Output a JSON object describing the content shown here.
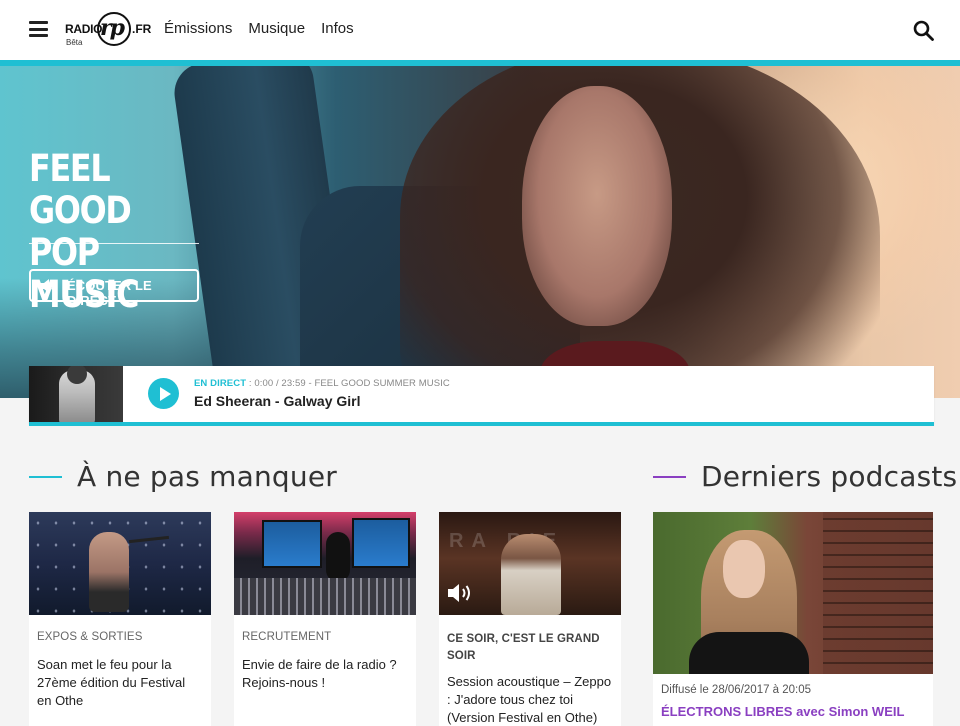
{
  "header": {
    "logo_left": "RADIO",
    "logo_mark": "rp",
    "logo_right": ".FR",
    "logo_badge": "Bêta",
    "nav": [
      "Émissions",
      "Musique",
      "Infos"
    ],
    "accent_color": "#1fbfd3"
  },
  "hero": {
    "title": "FEEL GOOD POP MUSIC",
    "listen_label": "ÉCOUTER LE DIRECT"
  },
  "player": {
    "live_label": "EN DIRECT",
    "schedule": " : 0:00 / 23:59 - FEEL GOOD SUMMER MUSIC",
    "track": "Ed Sheeran - Galway Girl"
  },
  "sections": {
    "featured_title": "À ne pas manquer",
    "featured_color": "#1fbfd3",
    "podcasts_title": "Derniers podcasts",
    "podcasts_color": "#8a3fc1"
  },
  "cards": [
    {
      "category": "EXPOS & SORTIES",
      "text": "Soan met le feu pour la 27ème édition du Festival en Othe",
      "icon": "person-singing-image"
    },
    {
      "category": "RECRUTEMENT",
      "text": "Envie de faire de la radio ? Rejoins-nous !",
      "icon": "radio-studio-image"
    },
    {
      "category": "CE SOIR, C'EST LE GRAND SOIR",
      "text": "Session acoustique – Zeppo : J'adore tous chez toi (Version Festival en Othe)",
      "icon": "speaker-icon"
    }
  ],
  "podcast": {
    "date": "Diffusé le 28/06/2017 à 20:05",
    "title": "ÉLECTRONS LIBRES avec Simon WEIL"
  }
}
